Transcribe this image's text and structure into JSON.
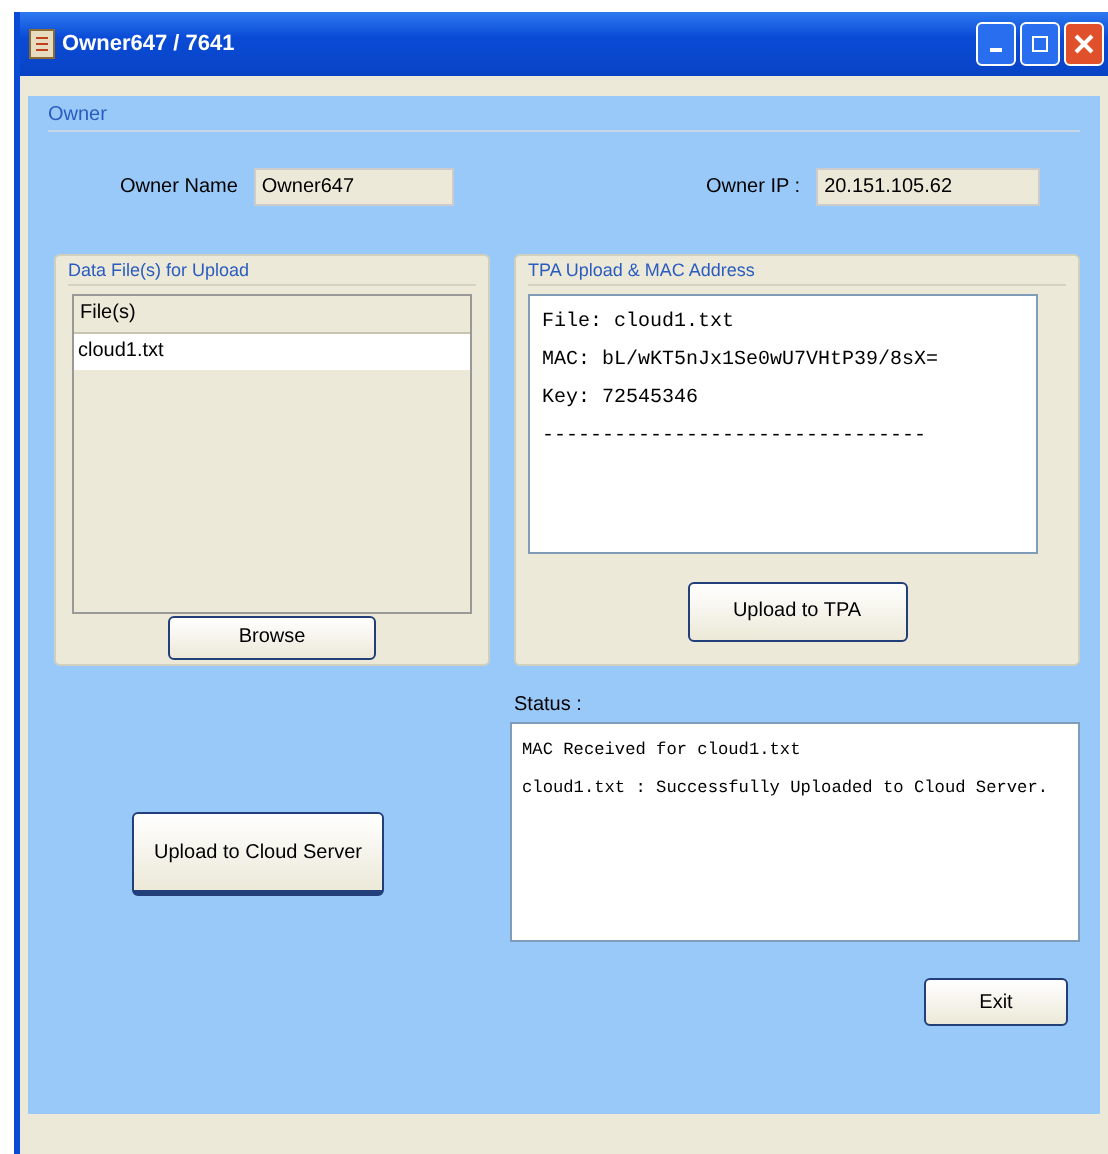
{
  "window": {
    "title": "Owner647 / 7641"
  },
  "owner": {
    "legend": "Owner",
    "name_label": "Owner Name",
    "name_value": "Owner647",
    "ip_label": "Owner IP :",
    "ip_value": "20.151.105.62"
  },
  "files_group": {
    "legend": "Data File(s) for Upload",
    "column": "File(s)",
    "rows": [
      {
        "name": "cloud1.txt",
        "selected": true
      }
    ],
    "button": "Browse"
  },
  "tpa_group": {
    "legend": "TPA Upload & MAC Address",
    "lines": [
      "File: cloud1.txt",
      "MAC: bL/wKT5nJx1Se0wU7VHtP39/8sX=",
      "Key: 72545346",
      "--------------------------------"
    ],
    "button": "Upload to TPA"
  },
  "cloud_button": "Upload to Cloud Server",
  "status": {
    "label": "Status :",
    "lines": [
      "MAC Received for cloud1.txt",
      "cloud1.txt : Successfully Uploaded to Cloud Server."
    ]
  },
  "exit_button": "Exit"
}
